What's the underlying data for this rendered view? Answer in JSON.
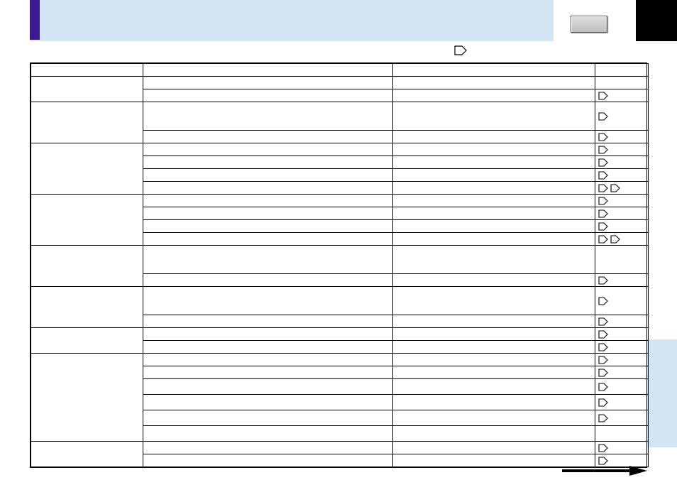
{
  "header": {
    "title": ""
  },
  "note_icon": "arrow-right",
  "table": {
    "head": {
      "c0": "",
      "c1": "",
      "c2": "",
      "c3": ""
    },
    "rows": [
      {
        "group": "",
        "item": "",
        "desc": "",
        "links": []
      },
      {
        "group": null,
        "item": "",
        "desc": "",
        "links": [
          "arrow"
        ]
      },
      {
        "group": "",
        "item": "",
        "desc": "",
        "links": [
          "arrow"
        ],
        "tall": true
      },
      {
        "group": null,
        "item": "",
        "desc": "",
        "links": [
          "arrow"
        ]
      },
      {
        "group": "",
        "item": "",
        "desc": "",
        "links": [
          "arrow"
        ]
      },
      {
        "group": null,
        "item": "",
        "desc": "",
        "links": [
          "arrow"
        ]
      },
      {
        "group": null,
        "item": "",
        "desc": "",
        "links": [
          "arrow"
        ]
      },
      {
        "group": null,
        "item": "",
        "desc": "",
        "links": [
          "arrow",
          "arrow"
        ]
      },
      {
        "group": "",
        "item": "",
        "desc": "",
        "links": [
          "arrow"
        ]
      },
      {
        "group": null,
        "item": "",
        "desc": "",
        "links": [
          "arrow"
        ]
      },
      {
        "group": null,
        "item": "",
        "desc": "",
        "links": [
          "arrow"
        ]
      },
      {
        "group": null,
        "item": "",
        "desc": "",
        "links": [
          "arrow",
          "arrow"
        ]
      },
      {
        "group": "",
        "item": "",
        "desc": "",
        "links": [],
        "tall": true
      },
      {
        "group": null,
        "item": "",
        "desc": "",
        "links": [
          "arrow"
        ]
      },
      {
        "group": "",
        "item": "",
        "desc": "",
        "links": [
          "arrow"
        ],
        "tall": true
      },
      {
        "group": null,
        "item": "",
        "desc": "",
        "links": [
          "arrow"
        ]
      },
      {
        "group": "",
        "item": "",
        "desc": "",
        "links": [
          "arrow"
        ]
      },
      {
        "group": null,
        "item": "",
        "desc": "",
        "links": [
          "arrow"
        ]
      },
      {
        "group": "",
        "item": "",
        "desc": "",
        "links": [
          "arrow"
        ]
      },
      {
        "group": null,
        "item": "",
        "desc": "",
        "links": [
          "arrow"
        ]
      },
      {
        "group": null,
        "item": "",
        "desc": "",
        "links": [
          "arrow"
        ],
        "tall22": true
      },
      {
        "group": null,
        "item": "",
        "desc": "",
        "links": [
          "arrow"
        ],
        "tall22": true
      },
      {
        "group": null,
        "item": "",
        "desc": "",
        "links": [
          "arrow"
        ],
        "tall22": true
      },
      {
        "group": null,
        "item": "",
        "desc": "",
        "links": [],
        "tall22": true
      },
      {
        "group": "",
        "item": "",
        "desc": "",
        "links": [
          "arrow"
        ]
      },
      {
        "group": null,
        "item": "",
        "desc": "",
        "links": [
          "arrow"
        ]
      }
    ]
  }
}
